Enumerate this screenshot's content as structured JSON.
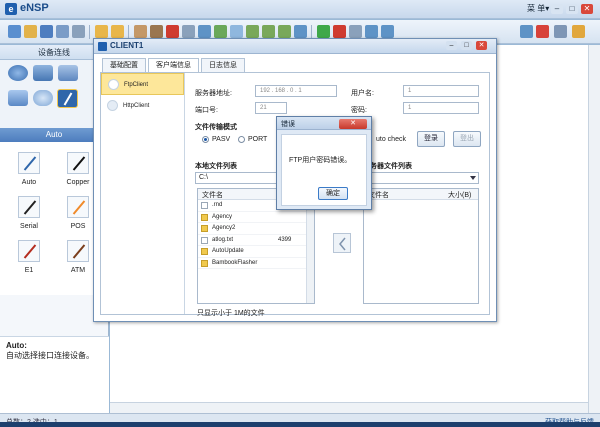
{
  "app": {
    "title": "eNSP",
    "menu": "菜 单▾"
  },
  "window_controls": {
    "minimize": "–",
    "maximize": "□",
    "close": "✕"
  },
  "left_panel": {
    "header": "设备连线",
    "sub_header": "Auto",
    "cables": [
      {
        "label": "Auto",
        "color": "#2f66aa"
      },
      {
        "label": "Copper",
        "color": "#111111"
      },
      {
        "label": "Serial",
        "color": "#222222"
      },
      {
        "label": "POS",
        "color": "#f08a2a"
      },
      {
        "label": "E1",
        "color": "#b42d1f"
      },
      {
        "label": "ATM",
        "color": "#7a3e1d"
      }
    ],
    "description": {
      "title": "Auto:",
      "text": "自动选择接口连接设备。"
    }
  },
  "status": {
    "left": "总数：2  选中：1",
    "right": "获取帮助与反馈"
  },
  "client": {
    "title": "CLIENT1",
    "tabs": [
      "基础配置",
      "客户端信息",
      "日志信息"
    ],
    "clients": [
      "FtpClient",
      "HttpClient"
    ],
    "server_addr_label": "服务器地址:",
    "server_addr": "192 . 168 . 0 . 1",
    "port_label": "端口号:",
    "port": "21",
    "username_label": "用户名:",
    "username": "1",
    "password_label": "密码:",
    "password": "1",
    "transfer_mode_label": "文件传输模式",
    "mode_pasv": "PASV",
    "mode_port": "PORT",
    "auto_check": "uto check",
    "login_button": "登录",
    "logout_button": "登出",
    "local_files_label": "本地文件列表",
    "local_path": "C:\\",
    "server_files_label": "服务器文件列表",
    "col_filename": "文件名",
    "col_size": "大小(B)",
    "local_files": [
      {
        "name": ".rnd",
        "size": "",
        "type": "file"
      },
      {
        "name": "Agency",
        "size": "",
        "type": "folder"
      },
      {
        "name": "Agency2",
        "size": "",
        "type": "folder"
      },
      {
        "name": "atlog.txt",
        "size": "4399",
        "type": "file"
      },
      {
        "name": "AutoUpdate",
        "size": "",
        "type": "folder"
      },
      {
        "name": "BambookFlasher",
        "size": "",
        "type": "folder"
      }
    ],
    "filter_note": "只显示小于 1M的文件"
  },
  "dialog": {
    "title": "错误",
    "close": "✕",
    "message": "FTP用户密码错误。",
    "ok_button": "确定"
  }
}
